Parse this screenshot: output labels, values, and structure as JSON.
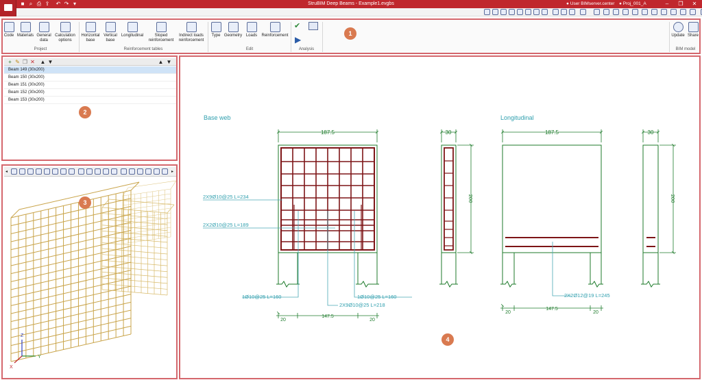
{
  "window": {
    "title": "StruBIM Deep Beams - Example1.evgbs",
    "user": "User BIMserver.center",
    "project": "Proj_001_A"
  },
  "ribbon": {
    "groups": {
      "project": "Project",
      "reinforcement_tables": "Reinforcement tables",
      "edit": "Edit",
      "analysis": "Analysis",
      "bim_model": "BIM model"
    },
    "buttons": {
      "code": "Code",
      "materials": "Materials",
      "general_data": "General data",
      "calculation_options": "Calculation options",
      "horizontal_base": "Horizontal base",
      "vertical_base": "Vertical base",
      "longitudinal": "Longitudinal",
      "sloped_reinforcement": "Sloped reinforcement",
      "indirect_loads_reinforcement": "Indirect loads reinforcement",
      "type": "Type",
      "geometry": "Geometry",
      "loads": "Loads",
      "reinforcement": "Reinforcement",
      "update": "Update",
      "share": "Share"
    }
  },
  "callouts": {
    "c1": "1",
    "c2": "2",
    "c3": "3",
    "c4": "4"
  },
  "beams": [
    {
      "label": "Beam 149 (30x200)"
    },
    {
      "label": "Beam 150 (30x200)"
    },
    {
      "label": "Beam 151 (30x200)"
    },
    {
      "label": "Beam 152 (30x200)"
    },
    {
      "label": "Beam 153 (30x200)"
    }
  ],
  "axes": {
    "z": "Z",
    "x": "X",
    "y": "Y"
  },
  "drawing": {
    "base_web_title": "Base web",
    "longitudinal_title": "Longitudinal",
    "dim_width": "187.5",
    "dim_thickness": "30",
    "dim_height": "200",
    "dim_support": "20",
    "dim_span": "147.5",
    "bar_horizontal": "2X9Ø10@25 L=234",
    "bar_horizontal_lower": "2X2Ø10@25 L=189",
    "bar_support_left": "1Ø10@25 L=160",
    "bar_support_right": "1Ø10@25 L=160",
    "bar_vertical": "2X9Ø10@25 L=218",
    "bar_longitudinal": "2X2Ø12@19 L=245"
  },
  "colors": {
    "accent": "#c0272d",
    "drawing_green": "#1c7a2a",
    "rebar": "#7d1416",
    "leader": "#4aa7b5",
    "callout": "#d97a50"
  }
}
